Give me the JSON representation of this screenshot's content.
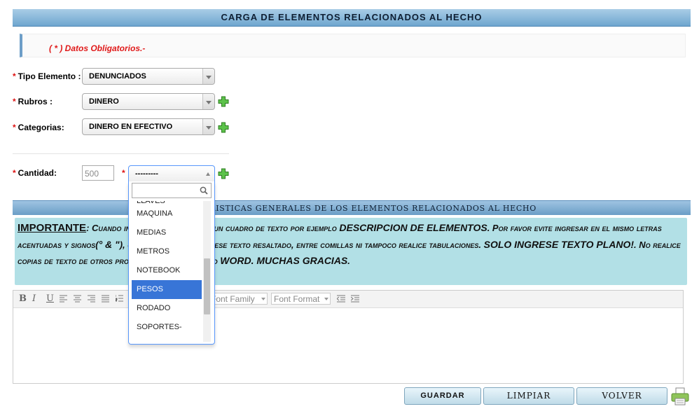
{
  "header": {
    "title": "CARGA DE ELEMENTOS RELACIONADOS AL HECHO"
  },
  "notice": {
    "text": "( * ) Datos Obligatorios.-"
  },
  "form": {
    "required_mark": "*",
    "tipo_elemento": {
      "label": "Tipo Elemento :",
      "value": "DENUNCIADOS"
    },
    "rubros": {
      "label": "Rubros :",
      "value": "DINERO"
    },
    "categorias": {
      "label": "Categorias:",
      "value": "DINERO EN EFECTIVO"
    },
    "cantidad": {
      "label": "Cantidad:",
      "placeholder": "500"
    },
    "unidad": {
      "value": "---------"
    }
  },
  "dropdown": {
    "partial_item": "LLAVES",
    "items": [
      "MAQUINA",
      "MEDIAS",
      "METROS",
      "NOTEBOOK",
      "PESOS",
      "RODADO",
      "SOPORTES-"
    ],
    "highlighted": "PESOS"
  },
  "section2": {
    "title": "CARACTERISTICAS GENERALES DE LOS ELEMENTOS RELACIONADOS AL HECHO"
  },
  "important": {
    "heading": "IMPORTANTE",
    "t1": ": Cuando ingrese informacion en un cuadro de texto por ejemplo ",
    "b1": "DESCRIPCION DE ELEMENTOS",
    "t2": ". Por favor evite ingresar en el mismo letras acentuadas y signos(",
    "b2": "° & \"",
    "t3": "), como asi mismo no ingrese texto resaltado, entre comillas ni tampoco realice tabulaciones. ",
    "b3": "SOLO INGRESE TEXTO PLANO!",
    "t4": ". No realice copias de texto de otros procesadores por ejemplo ",
    "b4": "WORD. MUCHAS GRACIAS",
    "t5": "."
  },
  "editor": {
    "bold": "B",
    "italic": "I",
    "underline": "U",
    "font_family": "Font Family",
    "font_format": "Font Format"
  },
  "buttons": {
    "guardar": "GUARDAR",
    "limpiar": "LIMPIAR",
    "volver": "VOLVER"
  },
  "colors": {
    "accent": "#6ea6cf",
    "required": "#e01a1a",
    "highlight": "#3875d7",
    "important_bg": "#b2e0e6"
  }
}
